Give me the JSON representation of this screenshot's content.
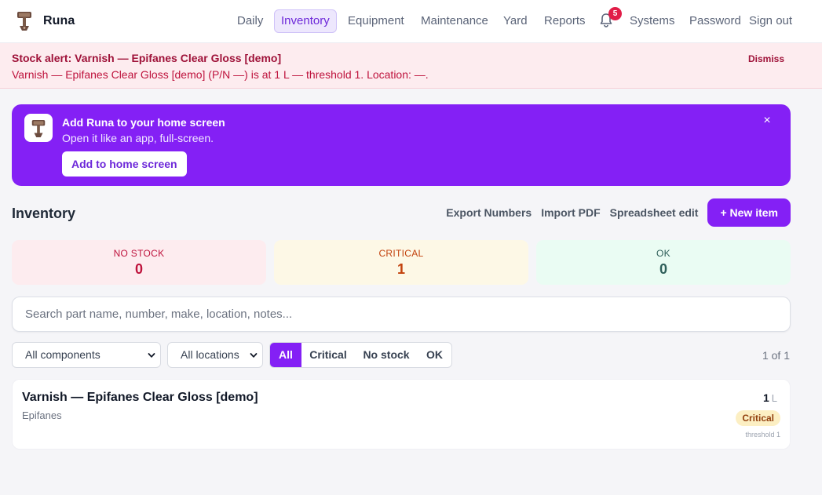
{
  "app": {
    "name": "Runa"
  },
  "nav": {
    "items": [
      {
        "label": "Daily"
      },
      {
        "label": "Inventory",
        "active": true
      },
      {
        "label": "Equipment"
      },
      {
        "label": "Maintenance"
      },
      {
        "label": "Yard"
      },
      {
        "label": "Reports"
      },
      {
        "label": "Systems"
      },
      {
        "label": "Password"
      },
      {
        "label": "Sign out"
      }
    ],
    "notifications": {
      "icon": "bell-icon",
      "count": "5"
    }
  },
  "alert": {
    "title": "Stock alert: Varnish — Epifanes Clear Gloss [demo]",
    "body": "Varnish — Epifanes Clear Gloss [demo] (P/N —) is at 1 L — threshold 1. Location: —.",
    "dismiss_label": "Dismiss"
  },
  "promo": {
    "title": "Add Runa to your home screen",
    "subtitle": "Open it like an app, full-screen.",
    "button_label": "Add to home screen",
    "close_glyph": "×"
  },
  "inventory": {
    "title": "Inventory",
    "actions": {
      "export": "Export Numbers",
      "import": "Import PDF",
      "spreadsheet": "Spreadsheet edit",
      "new_item": "+ New item"
    },
    "stats": {
      "no_stock": {
        "label": "NO STOCK",
        "value": "0"
      },
      "critical": {
        "label": "CRITICAL",
        "value": "1"
      },
      "ok": {
        "label": "OK",
        "value": "0"
      }
    },
    "search": {
      "placeholder": "Search part name, number, make, location, notes...",
      "value": ""
    },
    "filters": {
      "component": "All components",
      "location": "All locations",
      "status_options": [
        "All",
        "Critical",
        "No stock",
        "OK"
      ],
      "status_selected": "All"
    },
    "pager": "1 of 1",
    "items": [
      {
        "name": "Varnish — Epifanes Clear Gloss [demo]",
        "make": "Epifanes",
        "qty": "1",
        "unit": "L",
        "status": "Critical",
        "threshold": "threshold 1"
      }
    ]
  },
  "colors": {
    "accent": "#8420f5",
    "alert_bg": "#fdecef",
    "critical_text": "#c2410c",
    "no_stock_text": "#be123c",
    "ok_text": "#2f5f5a"
  }
}
